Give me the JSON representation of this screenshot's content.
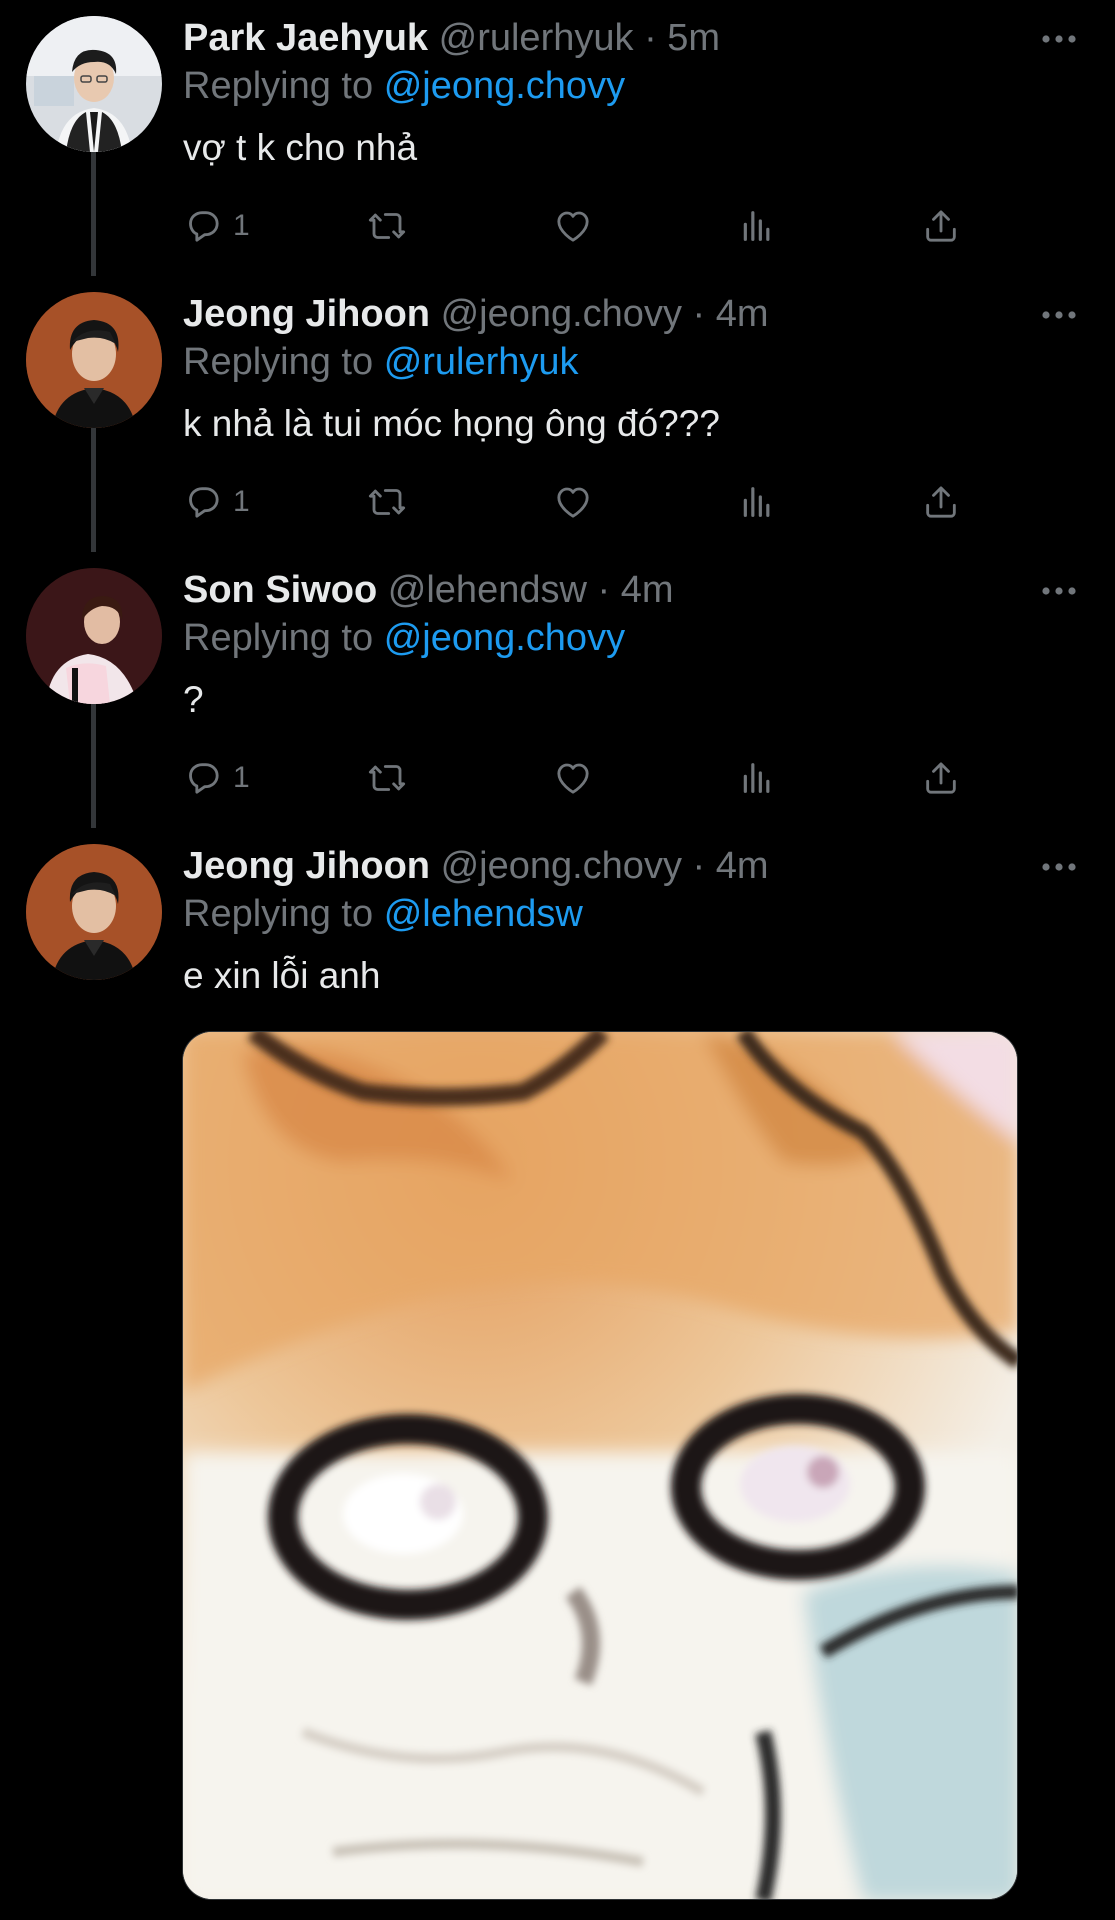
{
  "tweets": [
    {
      "name": "Park Jaehyuk",
      "handle": "@rulerhyuk",
      "time": "· 5m",
      "replying_prefix": "Replying to",
      "replying_to": "@jeong.chovy",
      "text": "vợ t k cho nhả",
      "reply_count": "1"
    },
    {
      "name": "Jeong Jihoon",
      "handle": "@jeong.chovy",
      "time": "· 4m",
      "replying_prefix": "Replying to",
      "replying_to": "@rulerhyuk",
      "text": "k nhả là tui móc họng ông đó???",
      "reply_count": "1"
    },
    {
      "name": "Son Siwoo",
      "handle": "@lehendsw",
      "time": "· 4m",
      "replying_prefix": "Replying to",
      "replying_to": "@jeong.chovy",
      "text": "?",
      "reply_count": "1"
    },
    {
      "name": "Jeong Jihoon",
      "handle": "@jeong.chovy",
      "time": "· 4m",
      "replying_prefix": "Replying to",
      "replying_to": "@lehendsw",
      "text": "e xin lỗi anh"
    }
  ],
  "icons": {
    "reply": "reply-icon",
    "retweet": "retweet-icon",
    "like": "heart-icon",
    "views": "analytics-icon",
    "share": "share-icon",
    "more": "more-icon"
  },
  "colors": {
    "background": "#000000",
    "text": "#e7e9ea",
    "secondary": "#71767b",
    "accent": "#1d9bf0",
    "thread_line": "#333639"
  }
}
